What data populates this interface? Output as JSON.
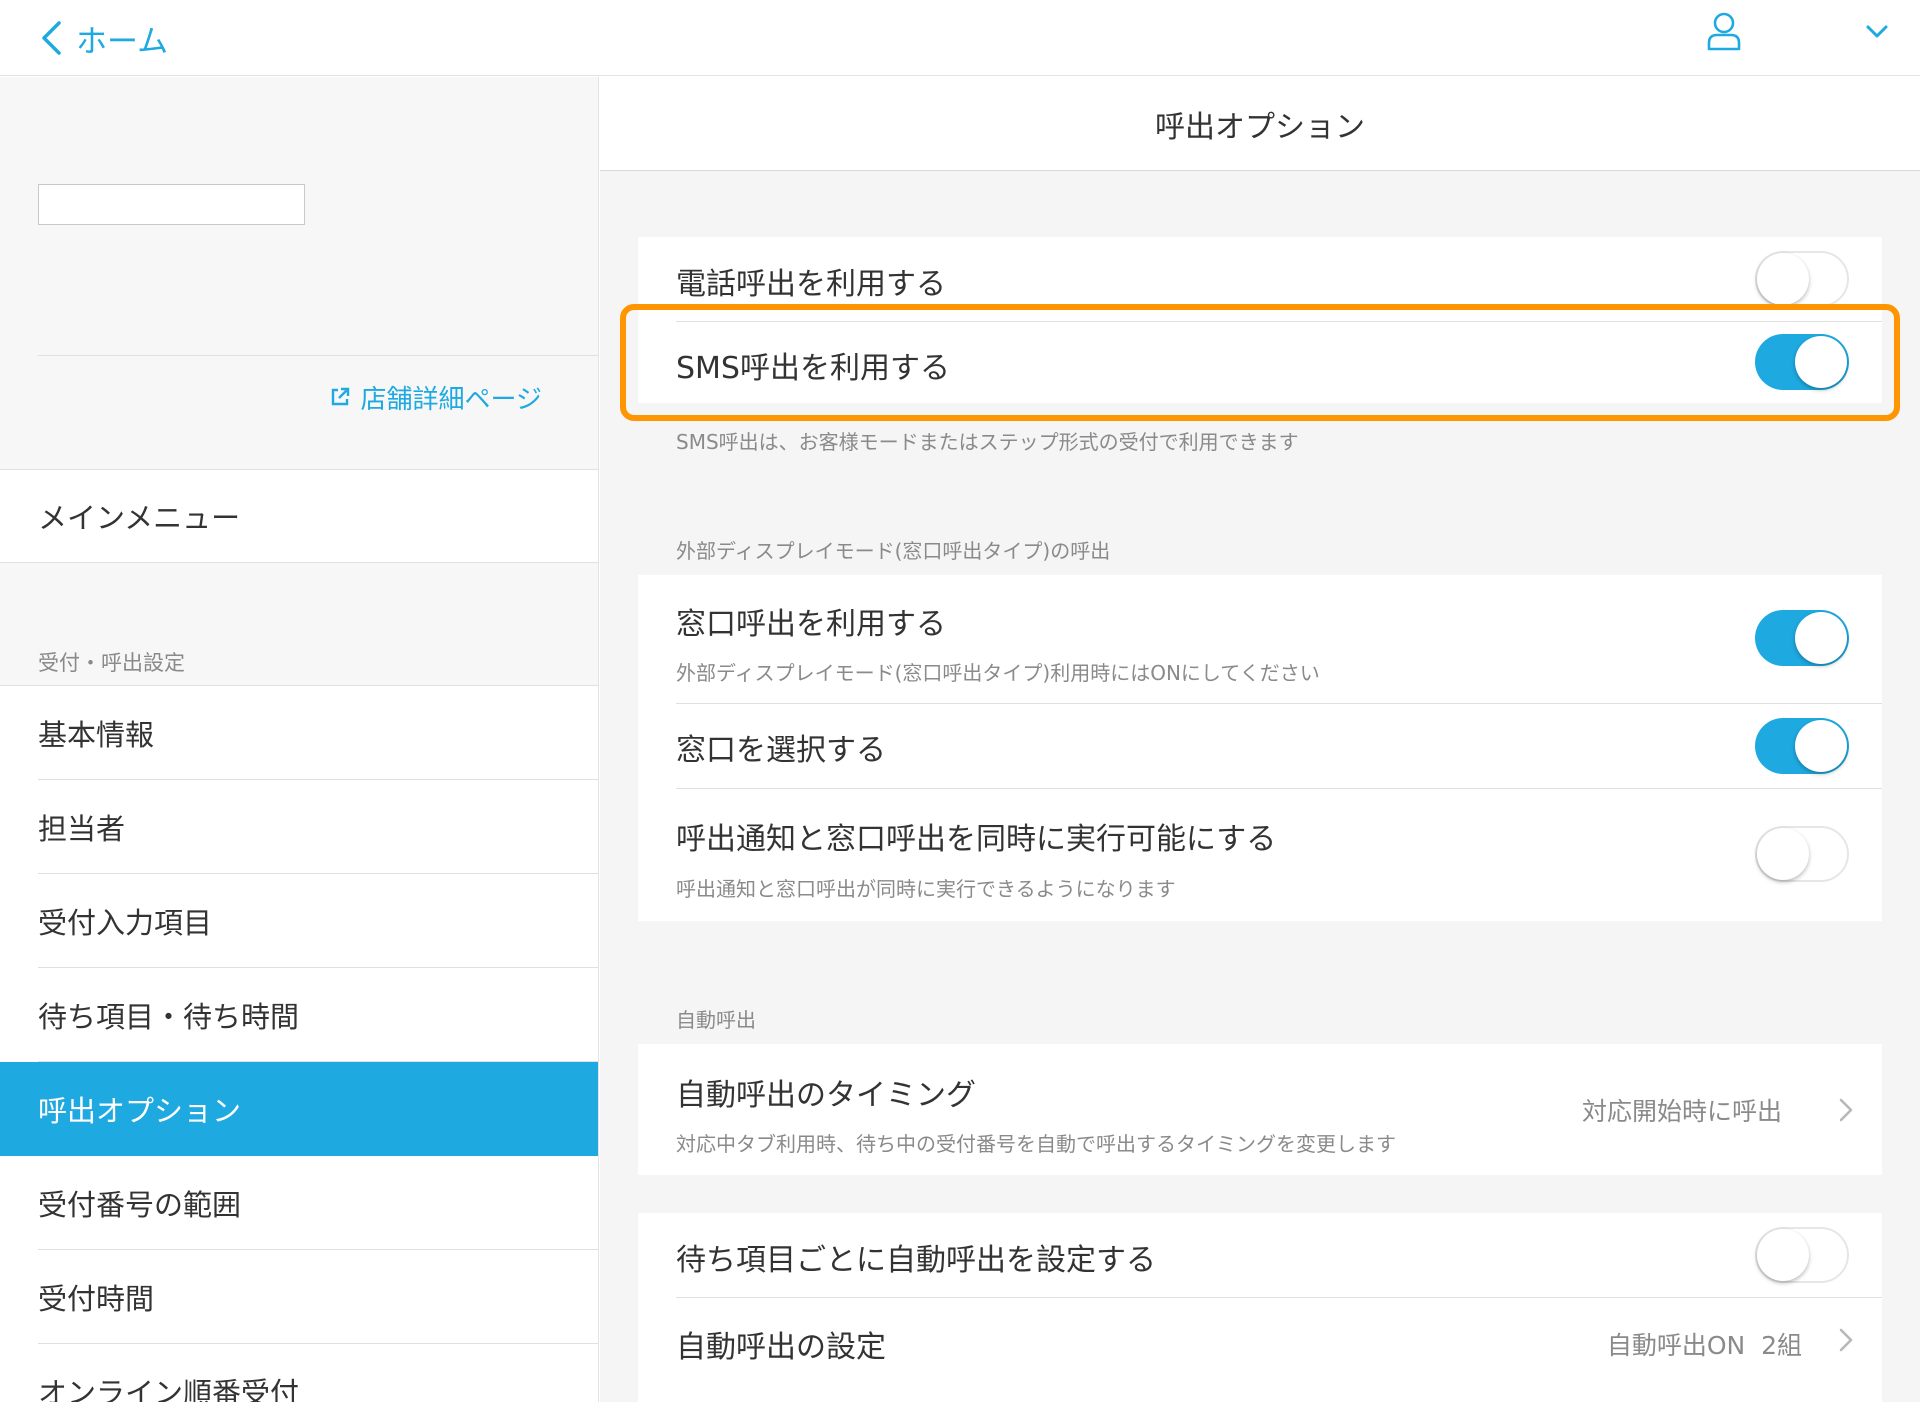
{
  "topbar": {
    "back_label": "ホーム"
  },
  "sidebar": {
    "store_link": "店舗詳細ページ",
    "main_menu": "メインメニュー",
    "section_label": "受付・呼出設定",
    "items": [
      {
        "label": "基本情報"
      },
      {
        "label": "担当者"
      },
      {
        "label": "受付入力項目"
      },
      {
        "label": "待ち項目・待ち時間"
      },
      {
        "label": "呼出オプション",
        "active": true
      },
      {
        "label": "受付番号の範囲"
      },
      {
        "label": "受付時間"
      },
      {
        "label": "オンライン順番受付"
      }
    ]
  },
  "main": {
    "title": "呼出オプション",
    "phone_call": {
      "label": "電話呼出を利用する",
      "enabled": false
    },
    "sms_call": {
      "label": "SMS呼出を利用する",
      "enabled": true
    },
    "sms_help": "SMS呼出は、お客様モードまたはステップ形式の受付で利用できます",
    "display_section": "外部ディスプレイモード(窓口呼出タイプ)の呼出",
    "window_call": {
      "label": "窓口呼出を利用する",
      "sub": "外部ディスプレイモード(窓口呼出タイプ)利用時にはONにしてください",
      "enabled": true
    },
    "window_select": {
      "label": "窓口を選択する",
      "enabled": true
    },
    "simultaneous": {
      "label": "呼出通知と窓口呼出を同時に実行可能にする",
      "sub": "呼出通知と窓口呼出が同時に実行できるようになります",
      "enabled": false
    },
    "auto_section": "自動呼出",
    "auto_timing": {
      "label": "自動呼出のタイミング",
      "sub": "対応中タブ利用時、待ち中の受付番号を自動で呼出するタイミングを変更します",
      "value": "対応開始時に呼出"
    },
    "per_item": {
      "label": "待ち項目ごとに自動呼出を設定する",
      "enabled": false
    },
    "auto_settings": {
      "label": "自動呼出の設定",
      "value": "自動呼出ON  2組"
    }
  },
  "colors": {
    "accent": "#1ea9e1",
    "highlight": "#ff9500"
  },
  "icons": [
    "back-chevron-icon",
    "user-icon",
    "chevron-down-icon",
    "external-link-icon",
    "chevron-right-icon"
  ]
}
